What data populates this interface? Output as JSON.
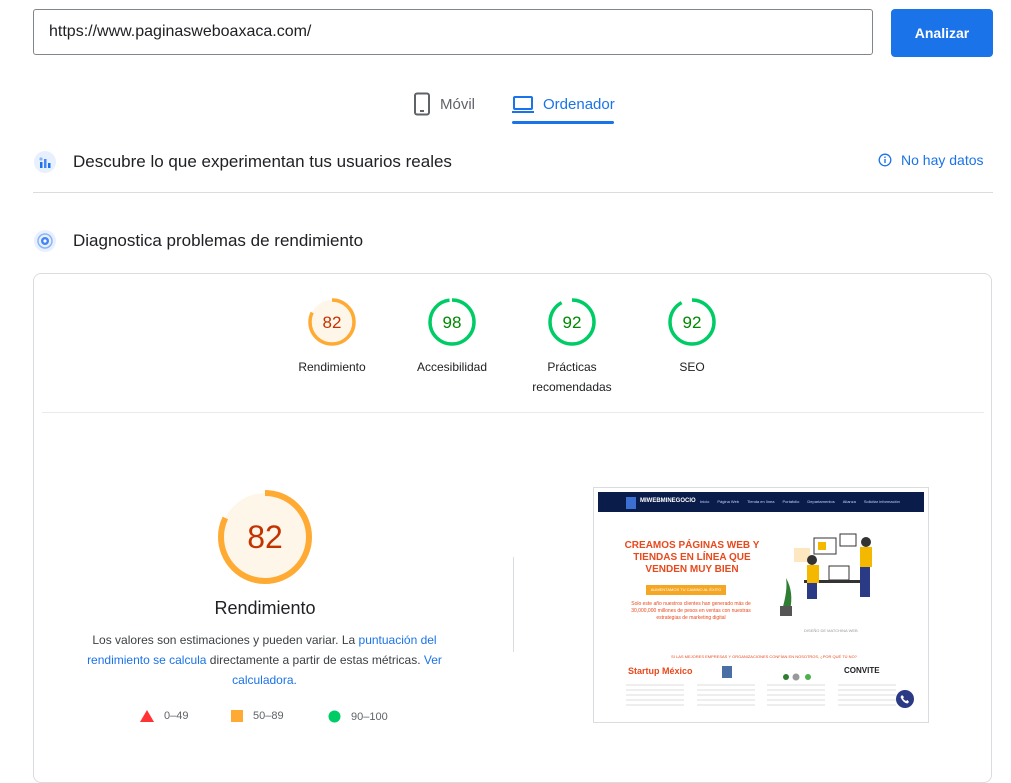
{
  "search": {
    "url_value": "https://www.paginasweboaxaca.com/",
    "analyze_label": "Analizar"
  },
  "device_tabs": [
    {
      "label": "Móvil",
      "icon": "phone-icon",
      "active": false
    },
    {
      "label": "Ordenador",
      "icon": "laptop-icon",
      "active": true
    }
  ],
  "field_data": {
    "title": "Descubre lo que experimentan tus usuarios reales",
    "status": "No hay datos",
    "status_icon": "info-icon"
  },
  "lab": {
    "title": "Diagnostica problemas de rendimiento",
    "scores": [
      {
        "value": "82",
        "label": "Rendimiento",
        "score": 82,
        "color": "#fa3",
        "text_color": "#c33300",
        "fill": "#fff6ea"
      },
      {
        "value": "98",
        "label": "Accesibilidad",
        "score": 98,
        "color": "#0c6",
        "text_color": "#008800",
        "fill": "#ffffff"
      },
      {
        "value": "92",
        "label": "Prácticas recomendadas",
        "score": 92,
        "color": "#0c6",
        "text_color": "#008800",
        "fill": "#ffffff"
      },
      {
        "value": "92",
        "label": "SEO",
        "score": 92,
        "color": "#0c6",
        "text_color": "#008800",
        "fill": "#ffffff"
      }
    ],
    "main_score": {
      "value": "82",
      "score": 82,
      "title": "Rendimiento"
    },
    "description": {
      "part1": "Los valores son estimaciones y pueden variar. La ",
      "link1": "puntuación del rendimiento se calcula",
      "part2": " directamente a partir de estas métricas. ",
      "link2": "Ver calculadora."
    },
    "legend": [
      {
        "range": "0–49",
        "shape": "triangle",
        "color": "#f33"
      },
      {
        "range": "50–89",
        "shape": "square",
        "color": "#fa3"
      },
      {
        "range": "90–100",
        "shape": "circle",
        "color": "#0c6"
      }
    ]
  },
  "thumbnail": {
    "logo": "MIWEBMINEGOCIO",
    "nav_links": [
      "Inicio",
      "Página Web",
      "Tienda en línea",
      "Portafolio",
      "Departamentos",
      "Alianza",
      "Solicitar información"
    ],
    "heading": "CREAMOS PÁGINAS WEB Y TIENDAS EN LÍNEA QUE VENDEN MUY BIEN",
    "cta": "AUMENTAMOS TU CAMINO AL ÉXITO",
    "small_text": "Solo este año nuestros clientes han generado más de 30,000,000 millones de pesos en ventas con nuestras estrategias de marketing digital",
    "caption": "DISEÑO DE MATCHINA WEB",
    "subheading": "SI LAS MEJORES EMPRESAS Y ORGANIZACIONES CONFÍAN EN NOSOTROS, ¿POR QUÉ TÚ NO?",
    "brand_left": "Startup México",
    "brand_right": "CONVITE"
  }
}
